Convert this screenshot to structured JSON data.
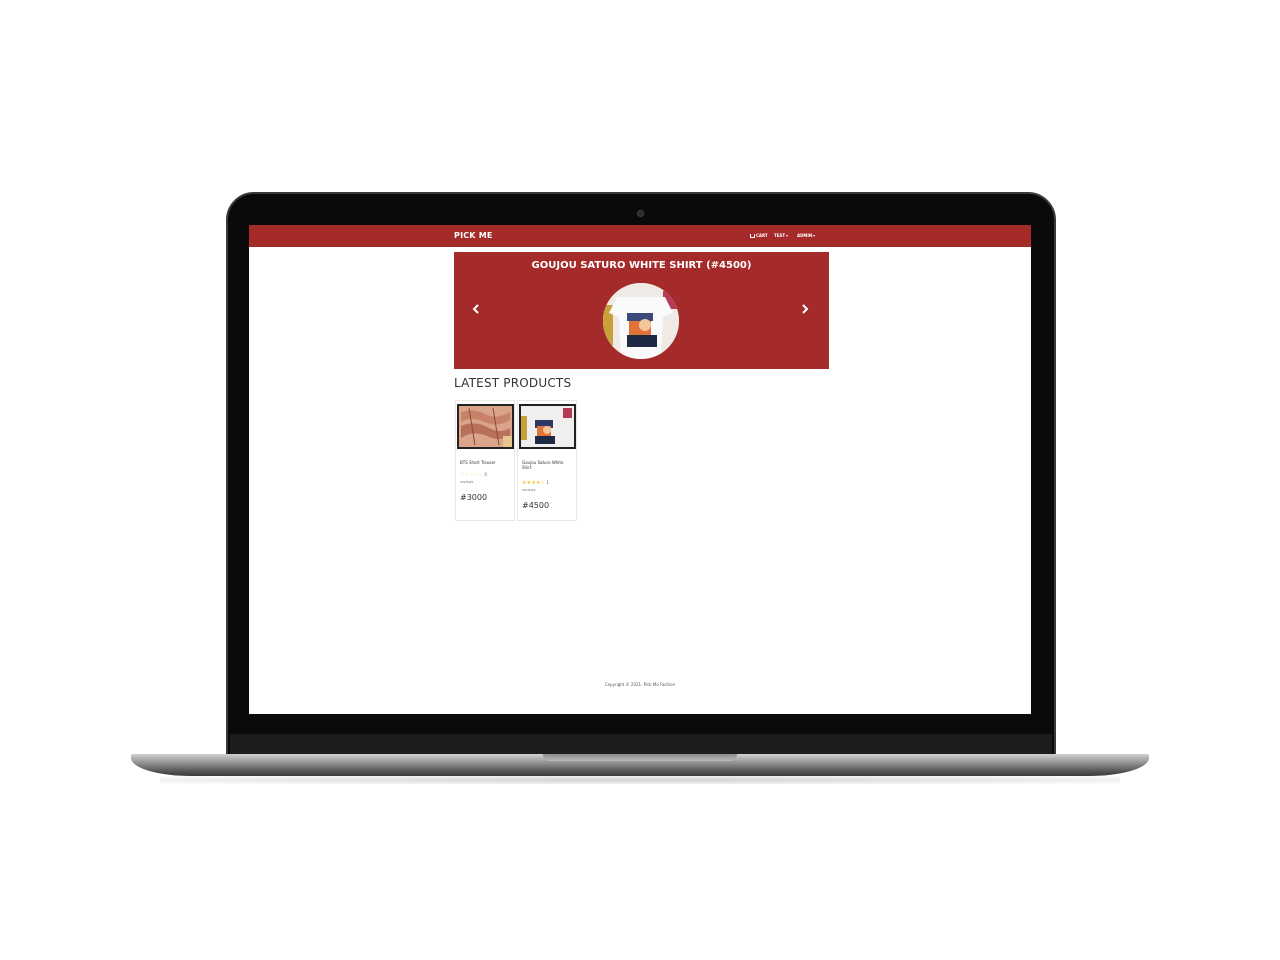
{
  "navbar": {
    "brand": "PICK ME",
    "cart_label": "CART",
    "test_label": "TEST",
    "admin_label": "ADMIN"
  },
  "carousel": {
    "title": "GOUJOU SATURO WHITE SHIRT (#4500)",
    "prev_icon": "chevron-left-icon",
    "next_icon": "chevron-right-icon"
  },
  "latest": {
    "title": "LATEST PRODUCTS",
    "products": [
      {
        "name": "BTS Short Trouser",
        "rating": 0,
        "stars": "☆☆☆☆☆",
        "review_count": "0",
        "reviews_label": "reviews",
        "price": "#3000"
      },
      {
        "name": "Goujou Saturo White Shirt",
        "rating": 4,
        "stars": "★★★★☆",
        "review_count": "1",
        "reviews_label": "reviews",
        "price": "#4500"
      }
    ]
  },
  "footer": {
    "copyright": "Copyright © 2021. Pick Me Fashion"
  },
  "colors": {
    "brand_red": "#a52a2a",
    "star": "#f0c419"
  }
}
